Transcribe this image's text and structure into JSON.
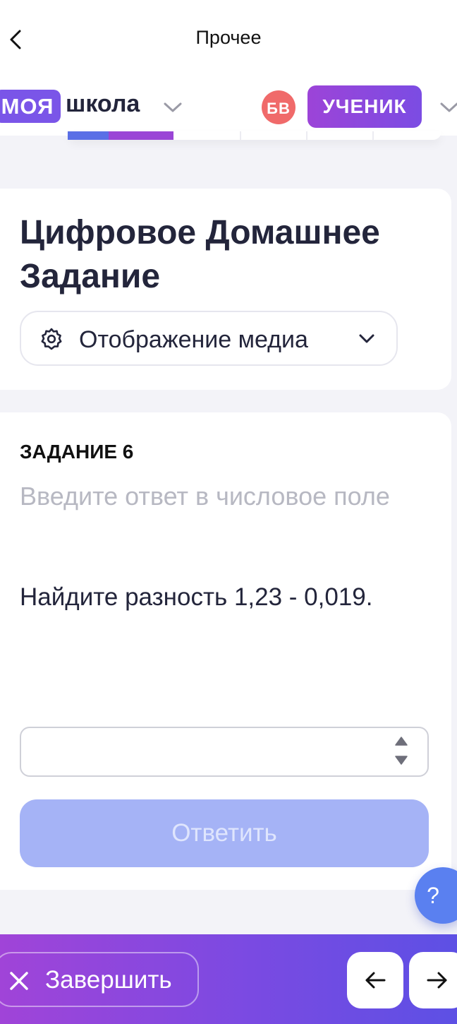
{
  "topbar": {
    "title": "Прочее",
    "back_icon": "chevron-left-icon"
  },
  "schoolbar": {
    "logo_part1": "МОЯ",
    "logo_part2": "школа",
    "avatar_initials": "БВ",
    "role_label": "УЧЕНИК"
  },
  "header_card": {
    "title": "Цифровое Домашнее Задание",
    "media_select_label": "Отображение медиа"
  },
  "task": {
    "number_label": "ЗАДАНИЕ 6",
    "hint": "Введите ответ в числовое поле",
    "question": "Найдите разность 1,23 - 0,019.",
    "answer_value": "",
    "submit_label": "Ответить"
  },
  "help": {
    "label": "?"
  },
  "bottombar": {
    "finish_label": "Завершить"
  },
  "colors": {
    "brand_purple": "#7a55e8",
    "role_gradient_start": "#9c44d8",
    "submit_disabled": "#a5b3f6",
    "avatar_bg": "#f06a6a",
    "help_bg": "#5a80f0"
  }
}
